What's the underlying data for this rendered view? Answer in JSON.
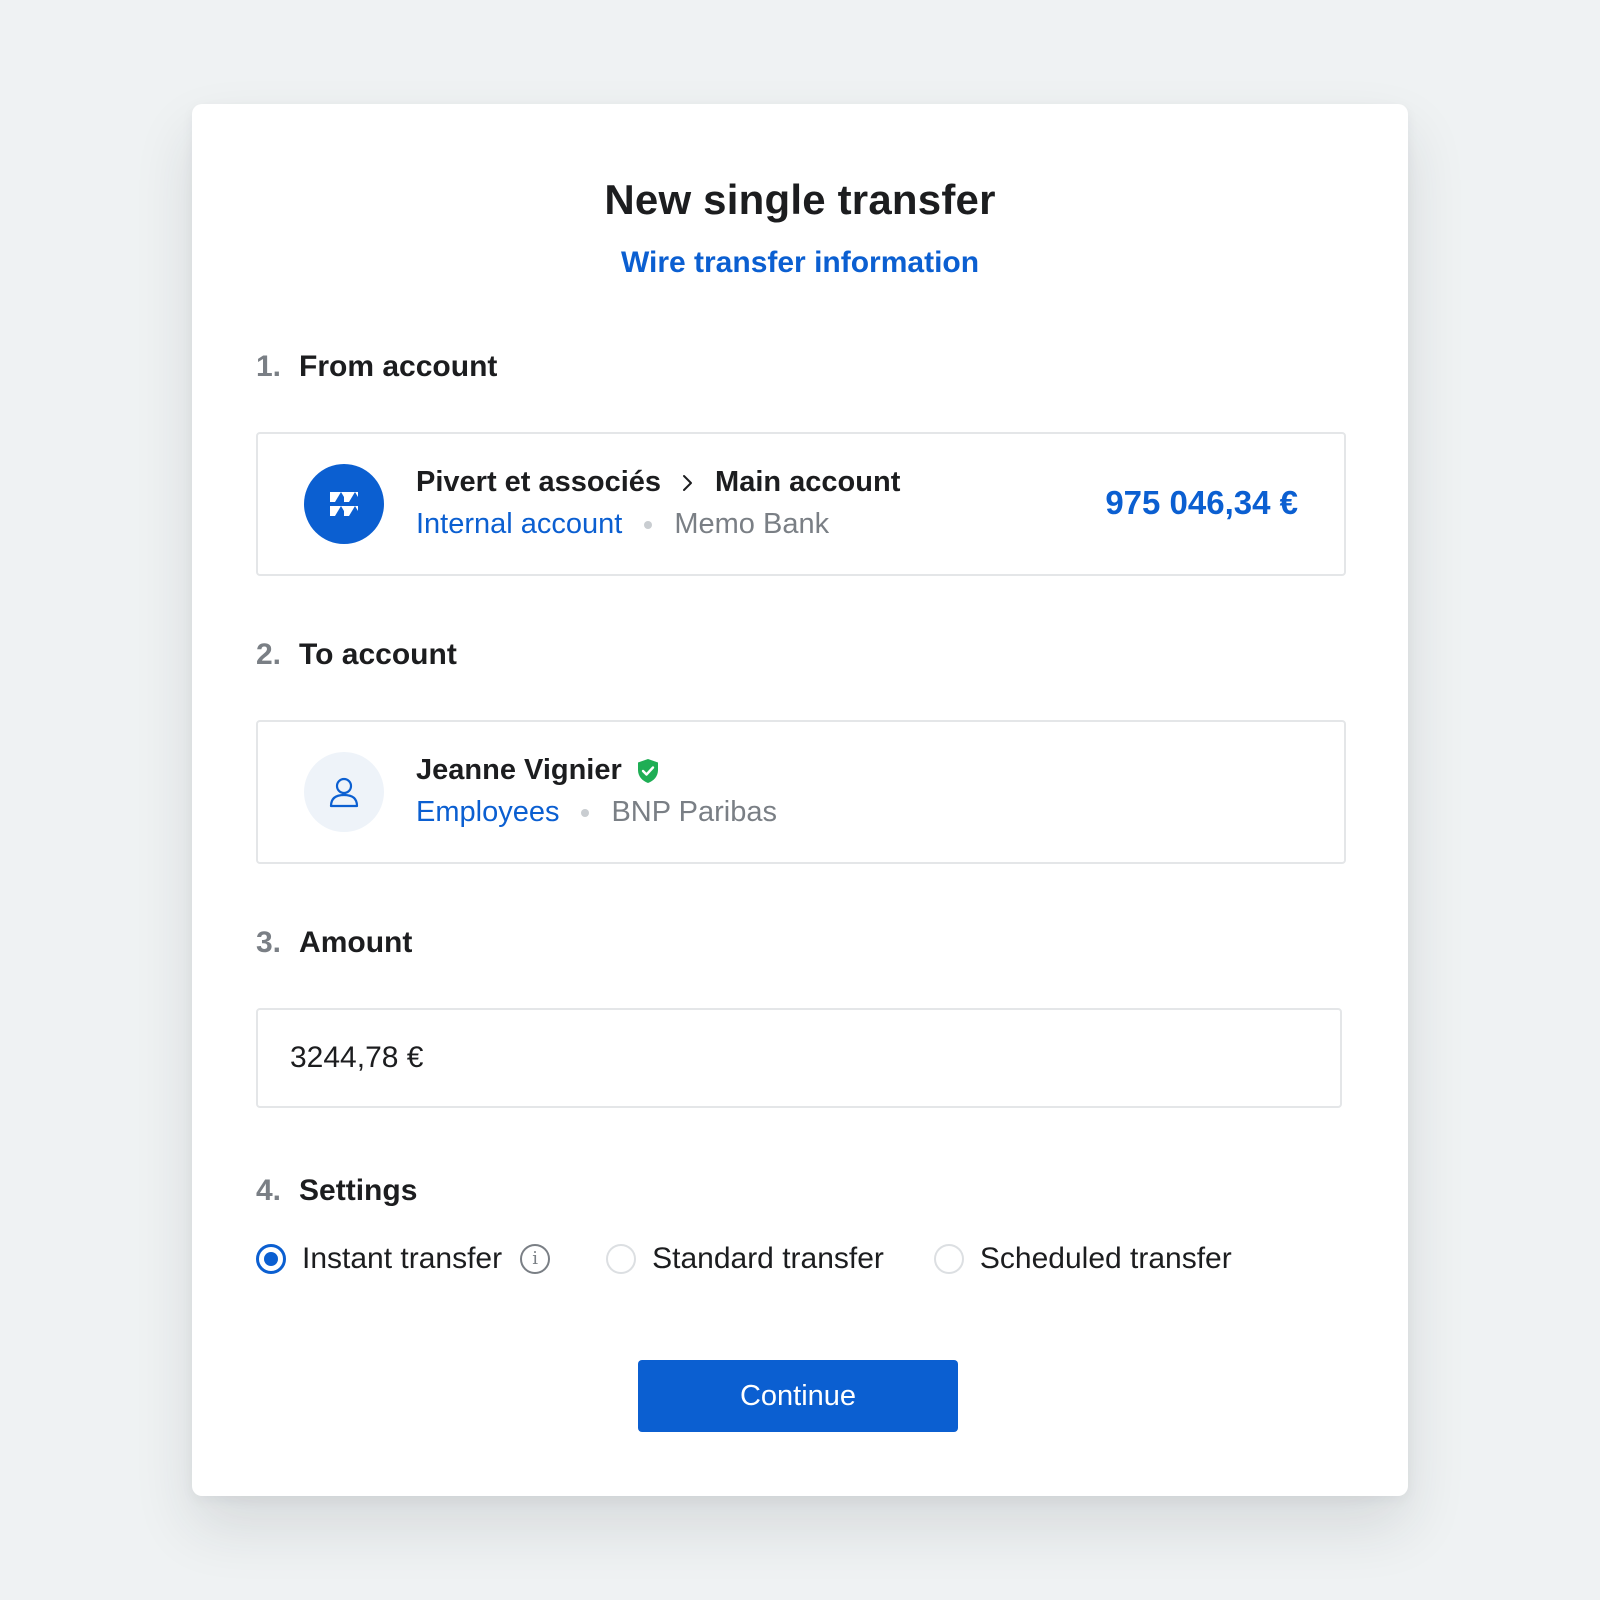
{
  "header": {
    "title": "New single transfer",
    "subtitle": "Wire transfer information"
  },
  "steps": [
    {
      "number": "1.",
      "label": "From account"
    },
    {
      "number": "2.",
      "label": "To account"
    },
    {
      "number": "3.",
      "label": "Amount"
    },
    {
      "number": "4.",
      "label": "Settings"
    }
  ],
  "from_account": {
    "company": "Pivert et associés",
    "account_name": "Main account",
    "type": "Internal account",
    "bank": "Memo Bank",
    "balance": "975 046,34 €",
    "logo_icon": "memo-bank-logo-icon",
    "verified": false
  },
  "to_account": {
    "name": "Jeanne Vignier",
    "group": "Employees",
    "bank": "BNP Paribas",
    "avatar_icon": "person-icon",
    "verified_icon": "verified-shield-icon",
    "verified": true
  },
  "amount": {
    "value": "3244,78 €"
  },
  "settings": {
    "options": [
      {
        "label": "Instant transfer",
        "selected": true,
        "has_info": true
      },
      {
        "label": "Standard transfer",
        "selected": false,
        "has_info": false
      },
      {
        "label": "Scheduled transfer",
        "selected": false,
        "has_info": false
      }
    ]
  },
  "actions": {
    "continue_label": "Continue"
  },
  "colors": {
    "accent": "#0b5fd1",
    "verified": "#1fae55",
    "muted": "#7a7f85",
    "background": "#eff2f3"
  }
}
